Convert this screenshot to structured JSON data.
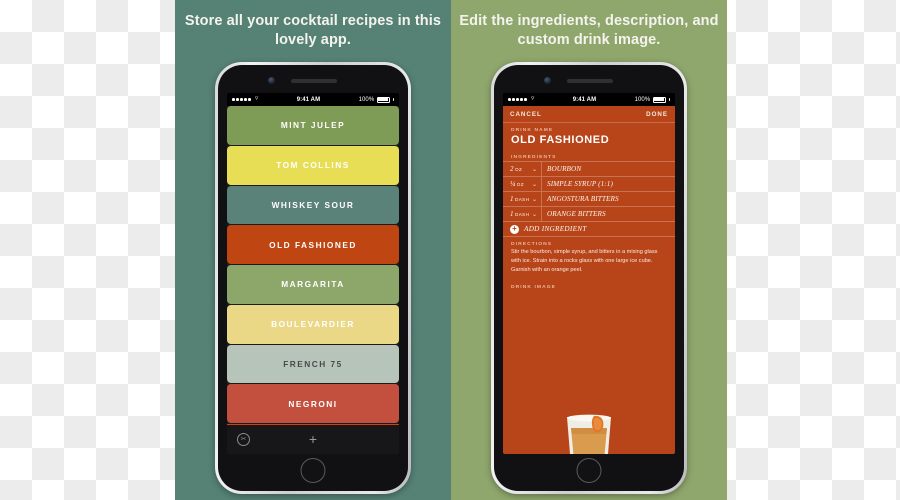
{
  "panels": {
    "left": {
      "headline": "Store all your cocktail recipes in this lovely app.",
      "bg_color": "#568275"
    },
    "right": {
      "headline": "Edit the ingredients, description, and custom drink image.",
      "bg_color": "#8fa76d"
    }
  },
  "status_bar": {
    "time": "9:41 AM",
    "battery_percent": "100%",
    "carrier_dots": 5,
    "wifi_icon": "wifi-icon"
  },
  "recipe_list": {
    "rows": [
      {
        "name": "MINT JULEP",
        "bg": "#7e9c55",
        "fg": "#ffffff"
      },
      {
        "name": "TOM COLLINS",
        "bg": "#e8de55",
        "fg": "#ffffff"
      },
      {
        "name": "WHISKEY SOUR",
        "bg": "#5a8279",
        "fg": "#ffffff"
      },
      {
        "name": "OLD FASHIONED",
        "bg": "#bf4512",
        "fg": "#ffffff"
      },
      {
        "name": "MARGARITA",
        "bg": "#8da669",
        "fg": "#ffffff"
      },
      {
        "name": "BOULEVARDIER",
        "bg": "#ead887",
        "fg": "#ffffff"
      },
      {
        "name": "FRENCH 75",
        "bg": "#b6c4ba",
        "fg": "#4a4a4a"
      },
      {
        "name": "NEGRONI",
        "bg": "#c3503f",
        "fg": "#ffffff"
      }
    ],
    "toolbar": {
      "shuffle_icon": "shuffle-dice-icon",
      "shuffle_glyph": "✂",
      "add_icon": "plus-icon",
      "add_glyph": "+"
    }
  },
  "editor": {
    "accent_color": "#b8451a",
    "nav": {
      "cancel_label": "CANCEL",
      "done_label": "DONE"
    },
    "drink_name": {
      "label": "DRINK NAME",
      "value": "OLD FASHIONED"
    },
    "ingredients": {
      "label": "INGREDIENTS",
      "items": [
        {
          "qty": "2",
          "unit": "OZ",
          "name": "BOURBON"
        },
        {
          "qty": "¼",
          "unit": "OZ",
          "name": "SIMPLE SYRUP (1:1)"
        },
        {
          "qty": "1",
          "unit": "DASH",
          "name": "ANGOSTURA BITTERS"
        },
        {
          "qty": "1",
          "unit": "DASH",
          "name": "ORANGE BITTERS"
        }
      ],
      "add_label": "ADD INGREDIENT",
      "add_icon": "plus-circle-icon",
      "chevron_icon": "chevron-down-icon",
      "chevron_glyph": "⌄"
    },
    "directions": {
      "label": "DIRECTIONS",
      "text": "Stir the bourbon, simple syrup, and bitters in a mixing glass with ice. Strain into a rocks glass with one large ice cube. Garnish with an orange peel."
    },
    "drink_image": {
      "label": "DRINK IMAGE",
      "alt": "rocks glass with amber cocktail and orange peel garnish"
    }
  }
}
